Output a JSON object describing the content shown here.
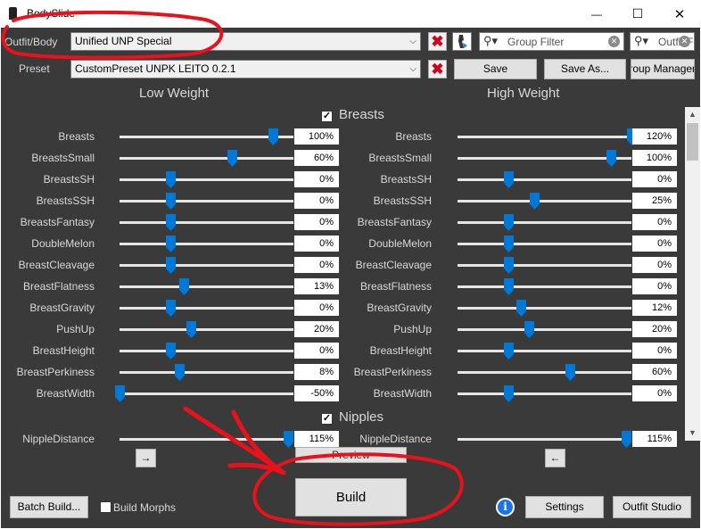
{
  "window": {
    "title": "BodySlide",
    "minimize": "—",
    "maximize": "☐",
    "close": "✕"
  },
  "top": {
    "outfit_label": "Outfit/Body",
    "outfit_value": "Unified UNP Special",
    "preset_label": "Preset",
    "preset_value": "CustomPreset UNPK LEITO 0.2.1",
    "group_filter_placeholder": "Group Filter",
    "outfit_filter_placeholder": "Outfit Filter",
    "save": "Save",
    "save_as": "Save As...",
    "group_manager": "Group Manager"
  },
  "headers": {
    "low": "Low Weight",
    "high": "High Weight"
  },
  "categories": [
    {
      "name": "Breasts",
      "checked": true,
      "sliders": [
        {
          "name": "Breasts",
          "low": 100,
          "high": 120,
          "low_text": "100%",
          "high_text": "120%"
        },
        {
          "name": "BreastsSmall",
          "low": 60,
          "high": 100,
          "low_text": "60%",
          "high_text": "100%"
        },
        {
          "name": "BreastsSH",
          "low": 0,
          "high": 0,
          "low_text": "0%",
          "high_text": "0%"
        },
        {
          "name": "BreastsSSH",
          "low": 0,
          "high": 25,
          "low_text": "0%",
          "high_text": "25%"
        },
        {
          "name": "BreastsFantasy",
          "low": 0,
          "high": 0,
          "low_text": "0%",
          "high_text": "0%"
        },
        {
          "name": "DoubleMelon",
          "low": 0,
          "high": 0,
          "low_text": "0%",
          "high_text": "0%"
        },
        {
          "name": "BreastCleavage",
          "low": 0,
          "high": 0,
          "low_text": "0%",
          "high_text": "0%"
        },
        {
          "name": "BreastFlatness",
          "low": 13,
          "high": 0,
          "low_text": "13%",
          "high_text": "0%"
        },
        {
          "name": "BreastGravity",
          "low": 0,
          "high": 12,
          "low_text": "0%",
          "high_text": "12%"
        },
        {
          "name": "PushUp",
          "low": 20,
          "high": 20,
          "low_text": "20%",
          "high_text": "20%"
        },
        {
          "name": "BreastHeight",
          "low": 0,
          "high": 0,
          "low_text": "0%",
          "high_text": "0%"
        },
        {
          "name": "BreastPerkiness",
          "low": 8,
          "high": 60,
          "low_text": "8%",
          "high_text": "60%"
        },
        {
          "name": "BreastWidth",
          "low": -50,
          "high": 0,
          "low_text": "-50%",
          "high_text": "0%"
        }
      ]
    },
    {
      "name": "Nipples",
      "checked": true,
      "sliders": [
        {
          "name": "NippleDistance",
          "low": 115,
          "high": 115,
          "low_text": "115%",
          "high_text": "115%"
        }
      ]
    }
  ],
  "nav": {
    "left_arrow": "→",
    "right_arrow": "←",
    "preview": "Preview"
  },
  "bottom": {
    "batch_build": "Batch Build...",
    "build_morphs": "Build Morphs",
    "build": "Build",
    "info": "i",
    "settings": "Settings",
    "outfit_studio": "Outfit Studio"
  },
  "colors": {
    "accent": "#0078d7",
    "annotation": "#e8121c",
    "panel": "#3a3a3a"
  }
}
